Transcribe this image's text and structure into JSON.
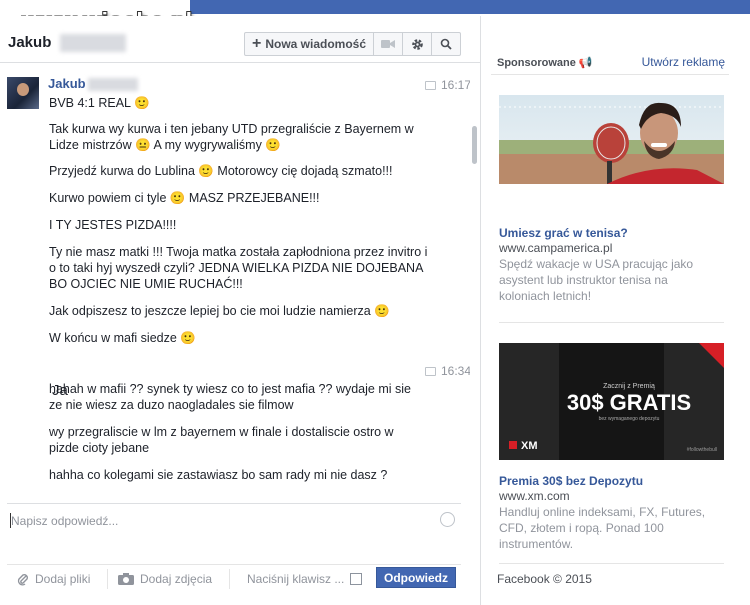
{
  "watermark": "www.wiocha.pl",
  "header": {
    "name": "Jakub",
    "new_message": "Nowa wiadomość"
  },
  "thread": [
    {
      "sender": "Jakub",
      "time": "16:17",
      "lines": [
        "BVB 4:1 REAL 🙂",
        "Tak kurwa wy kurwa i ten jebany UTD przegraliście z Bayernem w Lidze mistrzów 😐 A my wygrywaliśmy 🙂",
        "Przyjedź kurwa do Lublina 🙂 Motorowcy cię dojadą szmato!!!",
        "Kurwo powiem ci tyle 🙂 MASZ PRZEJEBANE!!!",
        "I TY JESTES PIZDA!!!!",
        "Ty nie masz matki !!! Twoja matka została zapłodniona przez invitro i o to taki hyj wyszedł czyli? JEDNA WIELKA PIZDA NIE DOJEBANA BO OJCIEC NIE UMIE RUCHAĆ!!!",
        "Jak odpiszesz to jeszcze lepiej bo cie  moi ludzie namierza 🙂",
        "W końcu w mafi siedze 🙂"
      ]
    },
    {
      "sender": "Ja",
      "time": "16:34",
      "lines": [
        "hahah w mafii ?? synek ty wiesz co to jest mafia ?? wydaje mi sie ze nie wiesz za duzo naogladales sie filmow",
        "wy przegraliscie w lm z bayernem w finale i dostaliscie ostro w pizde cioty jebane",
        "hahha co kolegami sie zastawiasz bo sam rady mi nie dasz ?"
      ]
    }
  ],
  "composer": {
    "placeholder": "Napisz odpowiedź...",
    "add_files": "Dodaj pliki",
    "add_photos": "Dodaj zdjęcia",
    "enter_hint": "Naciśnij klawisz ...",
    "send": "Odpowiedz"
  },
  "sidebar": {
    "sponsored": "Sponsorowane",
    "create_ad": "Utwórz reklamę",
    "ads": [
      {
        "title": "Umiesz grać w tenisa?",
        "url": "www.campamerica.pl",
        "desc": "Spędź wakacje w USA pracując jako asystent lub instruktor tenisa na koloniach letnich!"
      },
      {
        "title": "Premia 30$ bez Depozytu",
        "url": "www.xm.com",
        "desc": "Handluj online indeksami, FX, Futures, CFD, złotem i ropą. Ponad 100 instrumentów.",
        "banner": {
          "small": "Zacznij z Premią",
          "big": "30$ GRATIS",
          "sub": "bez wymaganego depozytu",
          "brand": "XM",
          "tag": "#followthebull"
        }
      }
    ],
    "footer": "Facebook © 2015"
  },
  "colors": {
    "brand": "#4267b2",
    "link": "#365899",
    "muted": "#90949c"
  }
}
